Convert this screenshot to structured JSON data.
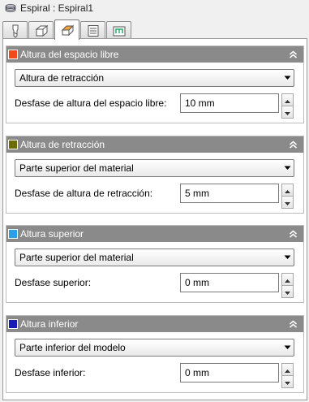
{
  "window": {
    "title": "Espiral : Espiral1",
    "icon": "spiral-icon"
  },
  "tabs": [
    {
      "icon": "tool-icon",
      "active": false
    },
    {
      "icon": "shape-icon",
      "active": false
    },
    {
      "icon": "heights-icon",
      "active": true
    },
    {
      "icon": "passes-icon",
      "active": false
    },
    {
      "icon": "linking-icon",
      "active": false
    }
  ],
  "groups": [
    {
      "title": "Altura del espacio libre",
      "color": "#f04a1c",
      "select_value": "Altura de retracción",
      "field_label": "Desfase de altura del espacio libre:",
      "field_value": "10 mm"
    },
    {
      "title": "Altura de retracción",
      "color": "#6b6b00",
      "select_value": "Parte superior del material",
      "field_label": "Desfase de altura de retracción:",
      "field_value": "5 mm"
    },
    {
      "title": "Altura superior",
      "color": "#2aa0e8",
      "select_value": "Parte superior del material",
      "field_label": "Desfase superior:",
      "field_value": "0 mm"
    },
    {
      "title": "Altura inferior",
      "color": "#1a1ab8",
      "select_value": "Parte inferior del modelo",
      "field_label": "Desfase inferior:",
      "field_value": "0 mm"
    }
  ]
}
